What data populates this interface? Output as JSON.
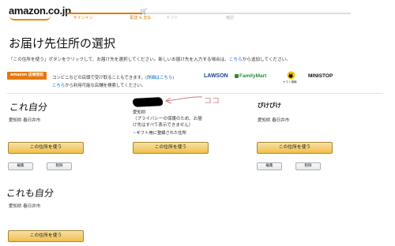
{
  "header": {
    "logo": "amazon.co.jp",
    "steps": [
      "サインイン",
      "配送 & 支払",
      "ギフト",
      "確認"
    ]
  },
  "page": {
    "title": "お届け先住所の選択",
    "instruction_pre": "「この住所を使う」ボタンをクリックして、お届け先を選択してください。新しいお届け先を入力する場合は、",
    "instruction_link": "こちら",
    "instruction_post": "から追加してください。"
  },
  "pickup": {
    "badge": "amazon 店頭受取",
    "text_pre": "コンビニなどの店頭で受け取ることもできます。",
    "details_link": "(詳細はこちら)",
    "text2_link": "こちら",
    "text2_post": "から利用可能な店舗を検索してください。",
    "stores": [
      "LAWSON",
      "FamilyMart",
      "ヤマト運輸",
      "MINISTOP"
    ]
  },
  "annotations": {
    "arrow_note": "ココ",
    "left_top": "これ自分",
    "left_bottom": "これも自分"
  },
  "addresses": [
    {
      "name": "",
      "line1": "愛知県 春日井市",
      "button": "この住所を使う",
      "edit": "編集",
      "delete": "削除"
    },
    {
      "name": "",
      "line1": "愛知県",
      "line2": "（プライバシーの保護のため、お届",
      "line3": "け先はすべて表示できません）",
      "gift_label": "ギフト用に登録された住所",
      "button": "この住所を使う"
    },
    {
      "name": "ぴけぴけ",
      "line1": "愛知県 春日井市",
      "button": "この住所を使う",
      "edit": "編集",
      "delete": "削除"
    },
    {
      "name": "",
      "line1": "愛知県 春日井市",
      "button": "この住所を使う"
    }
  ]
}
